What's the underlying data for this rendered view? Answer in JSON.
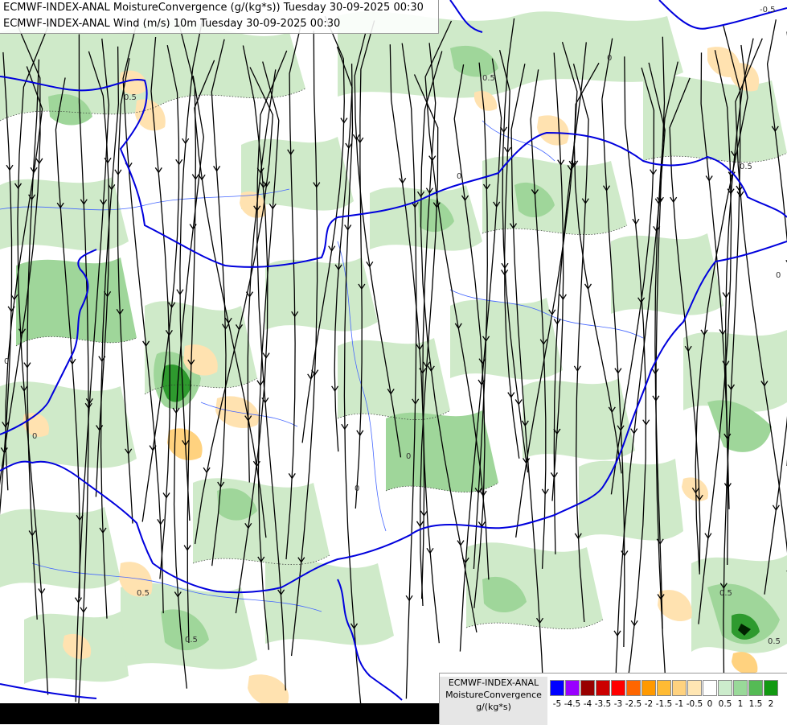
{
  "titles": {
    "line1": "ECMWF-INDEX-ANAL MoistureConvergence (g/(kg*s)) Tuesday 30-09-2025 00:30",
    "line2": "ECMWF-INDEX-ANAL Wind (m/s) 10m Tuesday 30-09-2025 00:30"
  },
  "legend": {
    "model": "ECMWF-INDEX-ANAL",
    "field": "MoistureConvergence",
    "unit": "g/(kg*s)",
    "tick_labels": [
      "-5",
      "-4.5",
      "-4",
      "-3.5",
      "-3",
      "-2.5",
      "-2",
      "-1.5",
      "-1",
      "-0.5",
      "0",
      "0.5",
      "1",
      "1.5",
      "2"
    ],
    "colors": [
      "#0000ff",
      "#9900ff",
      "#990000",
      "#cc0000",
      "#ff0000",
      "#ff6600",
      "#ff9900",
      "#ffbb33",
      "#ffd27f",
      "#ffe6b3",
      "#ffffff",
      "#cceccc",
      "#99d999",
      "#55bb55",
      "#119911"
    ]
  },
  "contour_labels": [
    "0",
    "0.5",
    "-0.5"
  ],
  "colors": {
    "border_blue": "#0000dd",
    "river_blue": "#4466ff",
    "streamline": "#000000",
    "green_light": "#cfeac9",
    "green_mid": "#9fd69a",
    "green_dark": "#2e9a2e",
    "orange_light": "#ffe2b0"
  }
}
